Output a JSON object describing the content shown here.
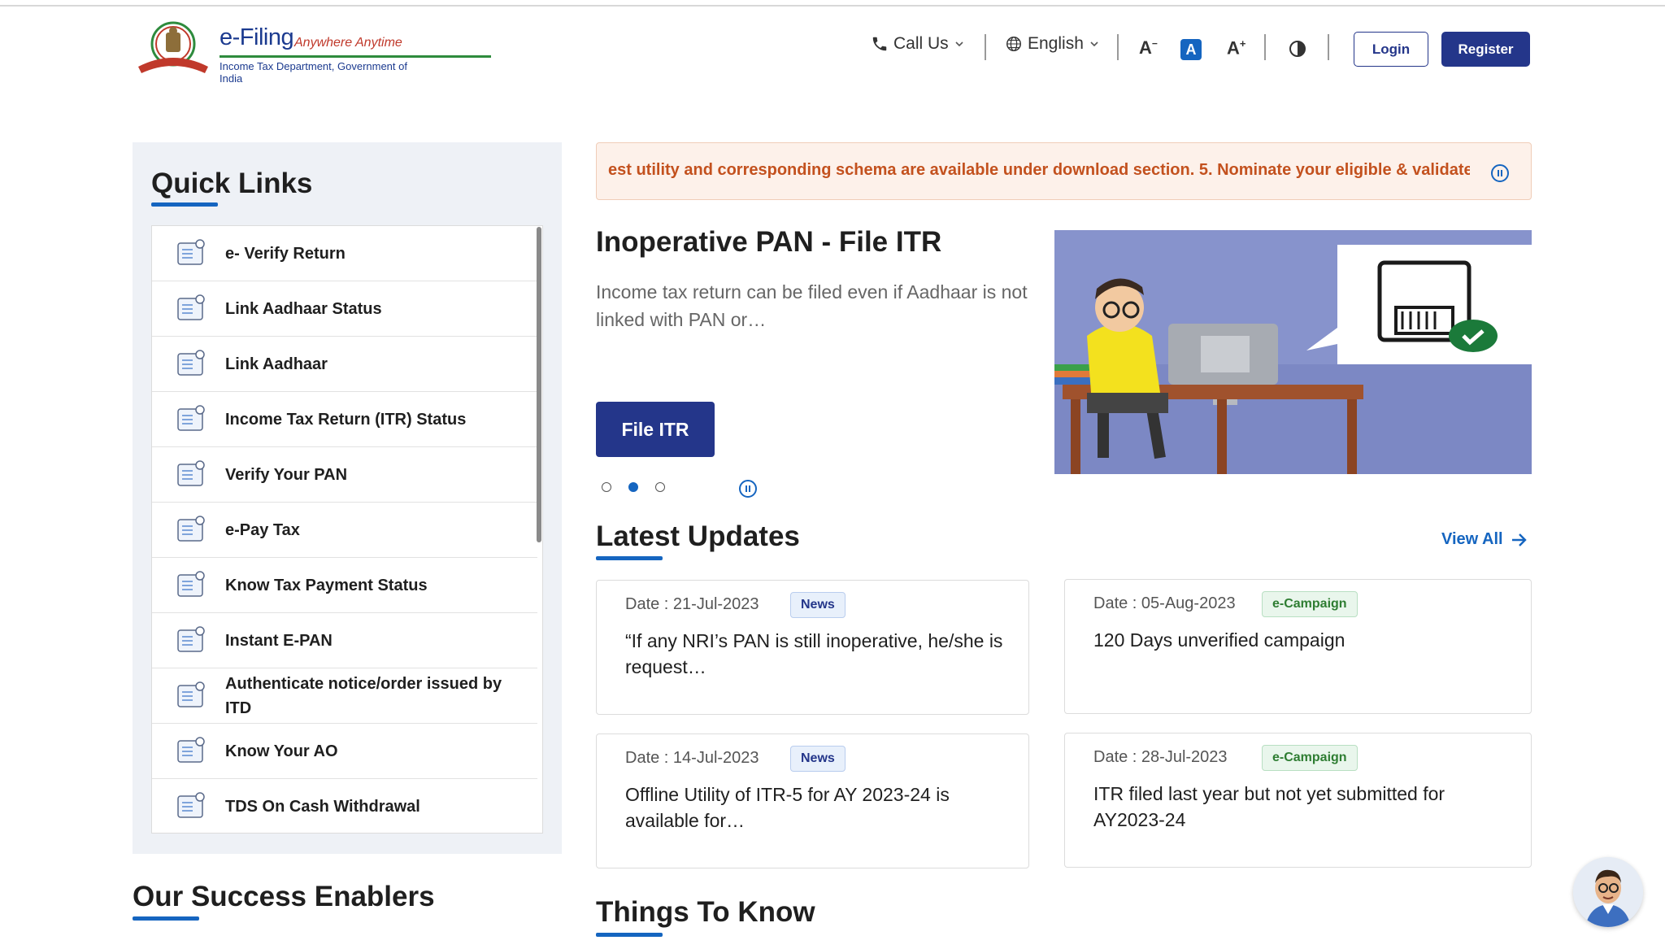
{
  "header": {
    "logo_title": "e-Filing",
    "logo_tagline": "Anywhere Anytime",
    "logo_subtitle": "Income Tax Department, Government of India",
    "call_us": "Call Us",
    "language": "English",
    "font_decrease": "A",
    "font_normal": "A",
    "font_increase": "A",
    "login": "Login",
    "register": "Register"
  },
  "quick_links": {
    "title": "Quick Links",
    "items": [
      {
        "label": "e- Verify Return",
        "icon": "verify-return-icon"
      },
      {
        "label": "Link Aadhaar Status",
        "icon": "aadhaar-card-icon"
      },
      {
        "label": "Link Aadhaar",
        "icon": "aadhaar-card-icon"
      },
      {
        "label": "Income Tax Return (ITR) Status",
        "icon": "itr-status-icon"
      },
      {
        "label": "Verify Your PAN",
        "icon": "pan-card-icon"
      },
      {
        "label": "e-Pay Tax",
        "icon": "pay-tax-icon"
      },
      {
        "label": "Know Tax Payment Status",
        "icon": "payment-status-icon"
      },
      {
        "label": "Instant E-PAN",
        "icon": "epan-icon"
      },
      {
        "label": "Authenticate notice/order issued by ITD",
        "icon": "notice-icon"
      },
      {
        "label": "Know Your AO",
        "icon": "ao-icon"
      },
      {
        "label": "TDS On Cash Withdrawal",
        "icon": "cash-withdrawal-icon"
      }
    ]
  },
  "success_enablers": {
    "title": "Our Success Enablers"
  },
  "ticker": {
    "text": "est utility and corresponding schema are available under download section. 5. Nominate your eligible & validated ba"
  },
  "carousel": {
    "title": "Inoperative PAN - File ITR",
    "description": "Income tax return can be filed even if Aadhaar is not linked with PAN or…",
    "button": "File ITR",
    "active_slide": 2,
    "slide_count": 3
  },
  "latest_updates": {
    "title": "Latest Updates",
    "view_all": "View All",
    "cards": [
      {
        "date": "Date : 21-Jul-2023",
        "badge": "News",
        "text": "“If any NRI’s PAN is still inoperative, he/she is request…"
      },
      {
        "date": "Date : 05-Aug-2023",
        "badge": "e-Campaign",
        "text": "120 Days unverified campaign"
      },
      {
        "date": "Date : 14-Jul-2023",
        "badge": "News",
        "text": "Offline Utility of ITR-5 for AY 2023-24 is available for…"
      },
      {
        "date": "Date : 28-Jul-2023",
        "badge": "e-Campaign",
        "text": "ITR filed last year but not yet submitted for AY2023-24"
      }
    ]
  },
  "things_to_know": {
    "title": "Things To Know"
  },
  "colors": {
    "primary": "#24368a",
    "accent_blue": "#1565c0",
    "ticker_text": "#c3511e",
    "campaign_green": "#2e7d32"
  }
}
